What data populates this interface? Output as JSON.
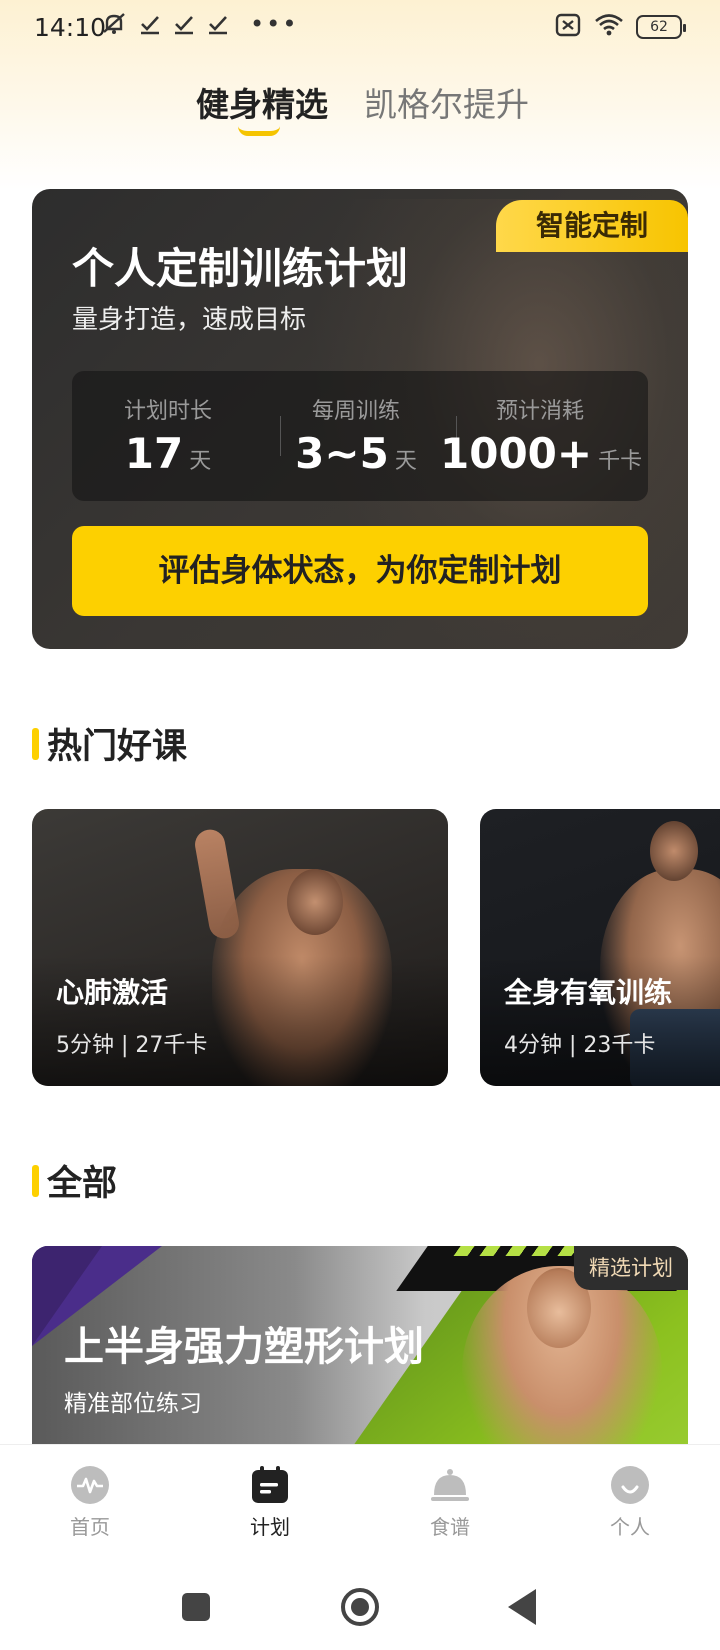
{
  "status_bar": {
    "time": "14:10",
    "left_icons": [
      "mute-icon",
      "check-icon",
      "check-icon",
      "check-icon",
      "more-dots-icon"
    ],
    "right_icons": [
      "sim-off-icon",
      "wifi-icon",
      "battery-icon"
    ],
    "battery": "62"
  },
  "header": {
    "tabs": [
      {
        "label": "健身精选",
        "active": true
      },
      {
        "label": "凯格尔提升",
        "active": false
      }
    ]
  },
  "plan_card": {
    "badge": "智能定制",
    "title": "个人定制训练计划",
    "subtitle": "量身打造，速成目标",
    "stats": [
      {
        "label": "计划时长",
        "value": "17",
        "unit": "天"
      },
      {
        "label": "每周训练",
        "value": "3~5",
        "unit": "天"
      },
      {
        "label": "预计消耗",
        "value": "1000+",
        "unit": "千卡"
      }
    ],
    "cta": "评估身体状态，为你定制计划"
  },
  "hot_section": {
    "title": "热门好课",
    "courses": [
      {
        "name": "心肺激活",
        "meta": "5分钟 | 27千卡"
      },
      {
        "name": "全身有氧训练",
        "meta": "4分钟 | 23千卡"
      }
    ]
  },
  "all_section": {
    "title": "全部",
    "plans": [
      {
        "badge": "精选计划",
        "title": "上半身强力塑形计划",
        "subtitle": "精准部位练习"
      }
    ]
  },
  "bottom_nav": {
    "items": [
      {
        "label": "首页",
        "icon": "pulse-icon"
      },
      {
        "label": "计划",
        "icon": "calendar-icon",
        "active": true
      },
      {
        "label": "食谱",
        "icon": "cloche-icon"
      },
      {
        "label": "个人",
        "icon": "profile-icon"
      }
    ]
  },
  "colors": {
    "accent": "#fdd000",
    "card_dark": "#2d2d2d",
    "text_primary": "#222222",
    "text_muted": "#999999"
  }
}
